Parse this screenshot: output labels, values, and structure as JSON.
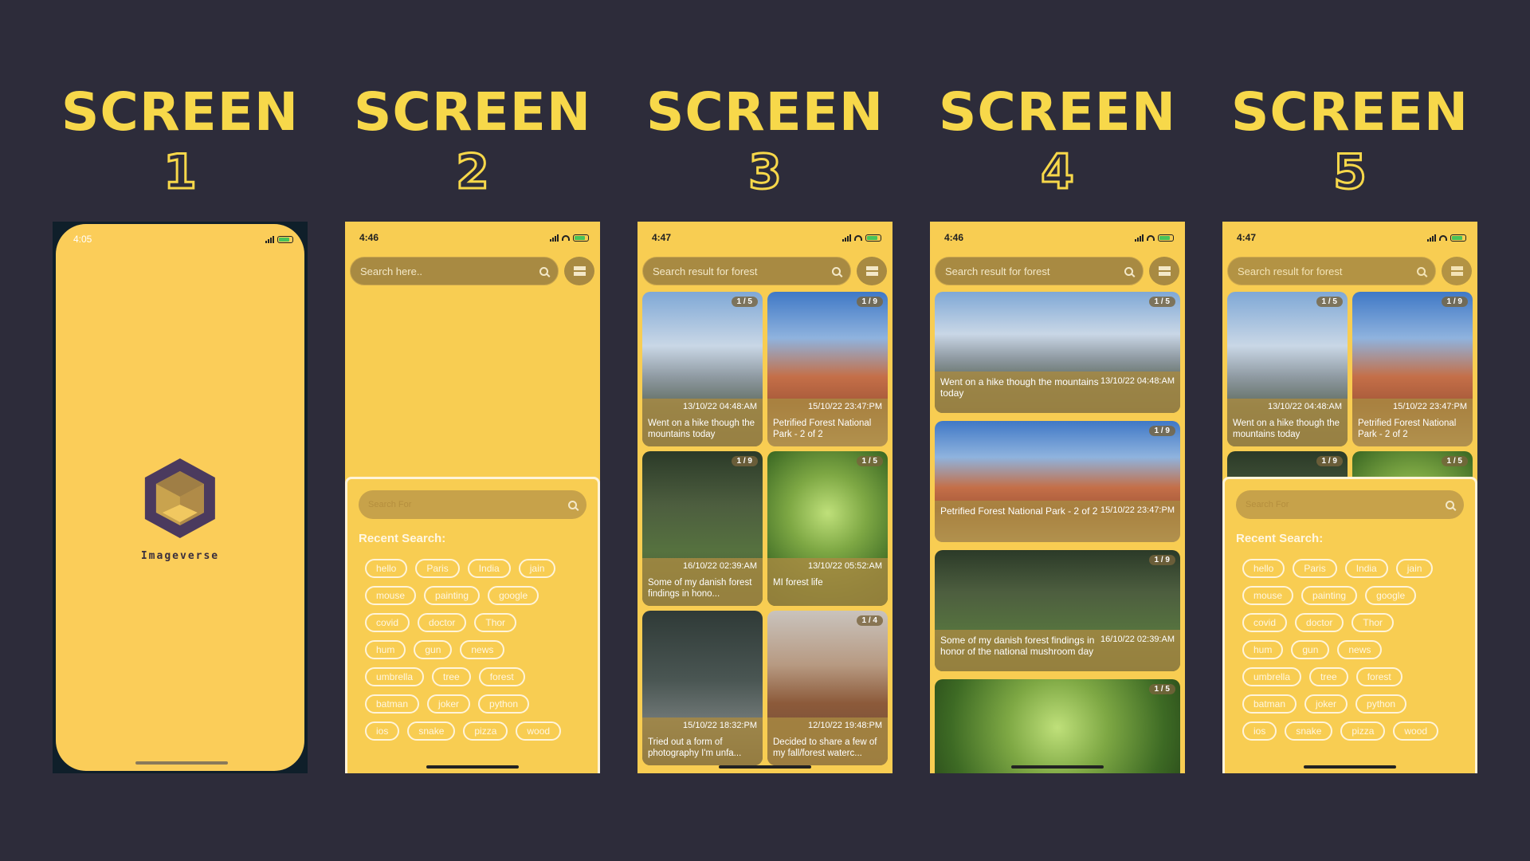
{
  "titles": [
    {
      "word": "SCREEN",
      "num": "1"
    },
    {
      "word": "SCREEN",
      "num": "2"
    },
    {
      "word": "SCREEN",
      "num": "3"
    },
    {
      "word": "SCREEN",
      "num": "4"
    },
    {
      "word": "SCREEN",
      "num": "5"
    }
  ],
  "screen1": {
    "time": "4:05",
    "app_name": "Imageverse"
  },
  "screen2": {
    "time": "4:46",
    "search_placeholder": "Search here.."
  },
  "screen3": {
    "time": "4:47",
    "search_text": "Search result for forest"
  },
  "screen4": {
    "time": "4:46",
    "search_text": "Search result for forest"
  },
  "screen5": {
    "time": "4:47",
    "search_text": "Search result for forest"
  },
  "panel": {
    "search_placeholder": "Search For",
    "recent_label": "Recent Search:",
    "rows": [
      [
        "hello",
        "Paris",
        "India",
        "jain"
      ],
      [
        "mouse",
        "painting",
        "google"
      ],
      [
        "covid",
        "doctor",
        "Thor"
      ],
      [
        "hum",
        "gun",
        "news"
      ],
      [
        "umbrella",
        "tree",
        "forest"
      ],
      [
        "batman",
        "joker",
        "python"
      ],
      [
        "ios",
        "snake",
        "pizza",
        "wood"
      ]
    ]
  },
  "grid_cards": [
    {
      "badge": "1 / 5",
      "date": "13/10/22 04:48:AM",
      "caption": "Went on a hike though the mountains today"
    },
    {
      "badge": "1 / 9",
      "date": "15/10/22 23:47:PM",
      "caption": "Petrified Forest National Park - 2 of 2"
    },
    {
      "badge": "1 / 9",
      "date": "16/10/22 02:39:AM",
      "caption": "Some of my danish forest findings in hono..."
    },
    {
      "badge": "1 / 5",
      "date": "13/10/22 05:52:AM",
      "caption": "MI forest life"
    },
    {
      "badge": "",
      "date": "15/10/22 18:32:PM",
      "caption": "Tried out a form of photography I'm unfa..."
    },
    {
      "badge": "1 / 4",
      "date": "12/10/22 19:48:PM",
      "caption": "Decided to share a few of my fall/forest waterc..."
    }
  ],
  "wide_cards": [
    {
      "badge": "1 / 5",
      "date": "13/10/22 04:48:AM",
      "caption": "Went on a hike though the mountains today"
    },
    {
      "badge": "1 / 9",
      "date": "15/10/22 23:47:PM",
      "caption": "Petrified Forest National Park - 2 of 2"
    },
    {
      "badge": "1 / 9",
      "date": "16/10/22 02:39:AM",
      "caption": "Some of my danish forest findings in honor of the national mushroom day"
    },
    {
      "badge": "1 / 5",
      "date": "",
      "caption": ""
    }
  ],
  "colors": {
    "background": "#2d2c3a",
    "accent": "#f7d84a",
    "app_bg": "#f8cd52",
    "bar": "#a88a42"
  }
}
